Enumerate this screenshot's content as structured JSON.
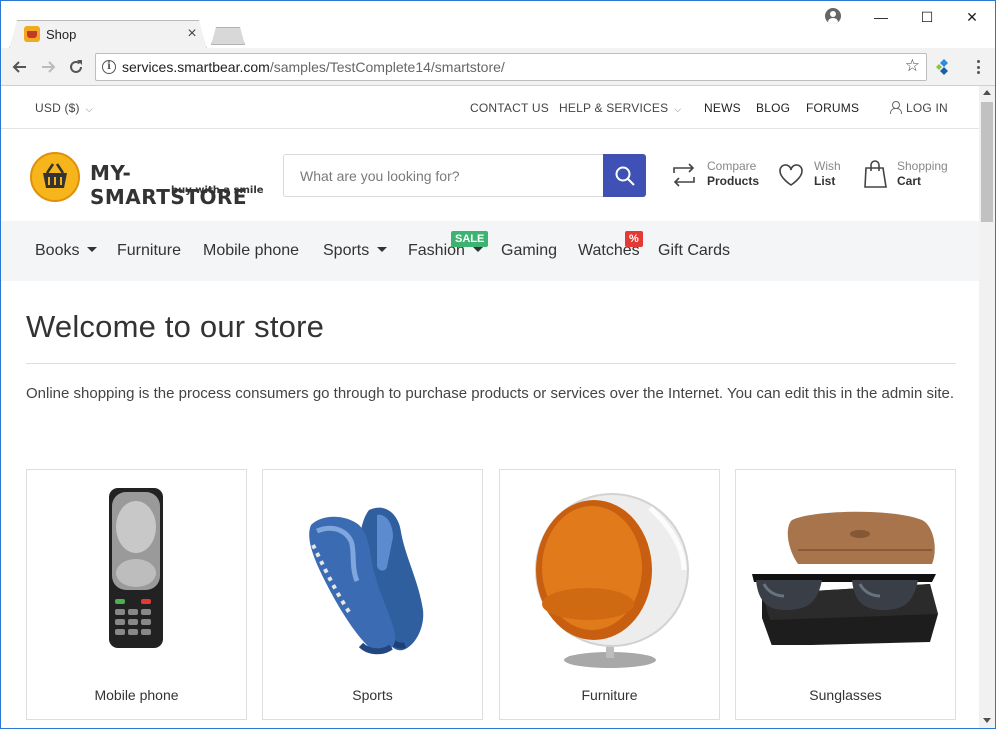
{
  "browser": {
    "tab_title": "Shop",
    "tab_close": "×",
    "url_host": "services.smartbear.com",
    "url_path": "/samples/TestComplete14/smartstore/",
    "back": "←",
    "forward": "→",
    "reload": "↻",
    "star": "☆",
    "win_minimize": "—",
    "win_maximize": "☐",
    "win_close": "✕"
  },
  "topbar": {
    "currency": "USD ($)",
    "links": [
      "CONTACT US",
      "HELP & SERVICES",
      "NEWS",
      "BLOG",
      "FORUMS"
    ],
    "login": "LOG IN"
  },
  "header": {
    "logo_text": "MY-SMARTSTORE",
    "logo_tagline": "buy with a smile",
    "search_placeholder": "What are you looking for?",
    "compare_small": "Compare",
    "compare_big": "Products",
    "wish_small": "Wish",
    "wish_big": "List",
    "cart_small": "Shopping",
    "cart_big": "Cart"
  },
  "menu": {
    "items": [
      "Books",
      "Furniture",
      "Mobile phone",
      "Sports",
      "Fashion",
      "Gaming",
      "Watches",
      "Gift Cards"
    ],
    "sale_badge": "SALE",
    "percent_badge": "%",
    "sale_color": "#3cb371",
    "percent_color": "#e53935"
  },
  "main": {
    "title": "Welcome to our store",
    "intro": "Online shopping is the process consumers go through to purchase products or services over the Internet. You can edit this in the admin site."
  },
  "categories": [
    {
      "label": "Mobile phone",
      "icon": "mobile-phone-image"
    },
    {
      "label": "Sports",
      "icon": "sneakers-image"
    },
    {
      "label": "Furniture",
      "icon": "ball-chair-image"
    },
    {
      "label": "Sunglasses",
      "icon": "sunglasses-image"
    }
  ],
  "colors": {
    "accent": "#3f51b5",
    "window_border": "#2b78d4"
  }
}
